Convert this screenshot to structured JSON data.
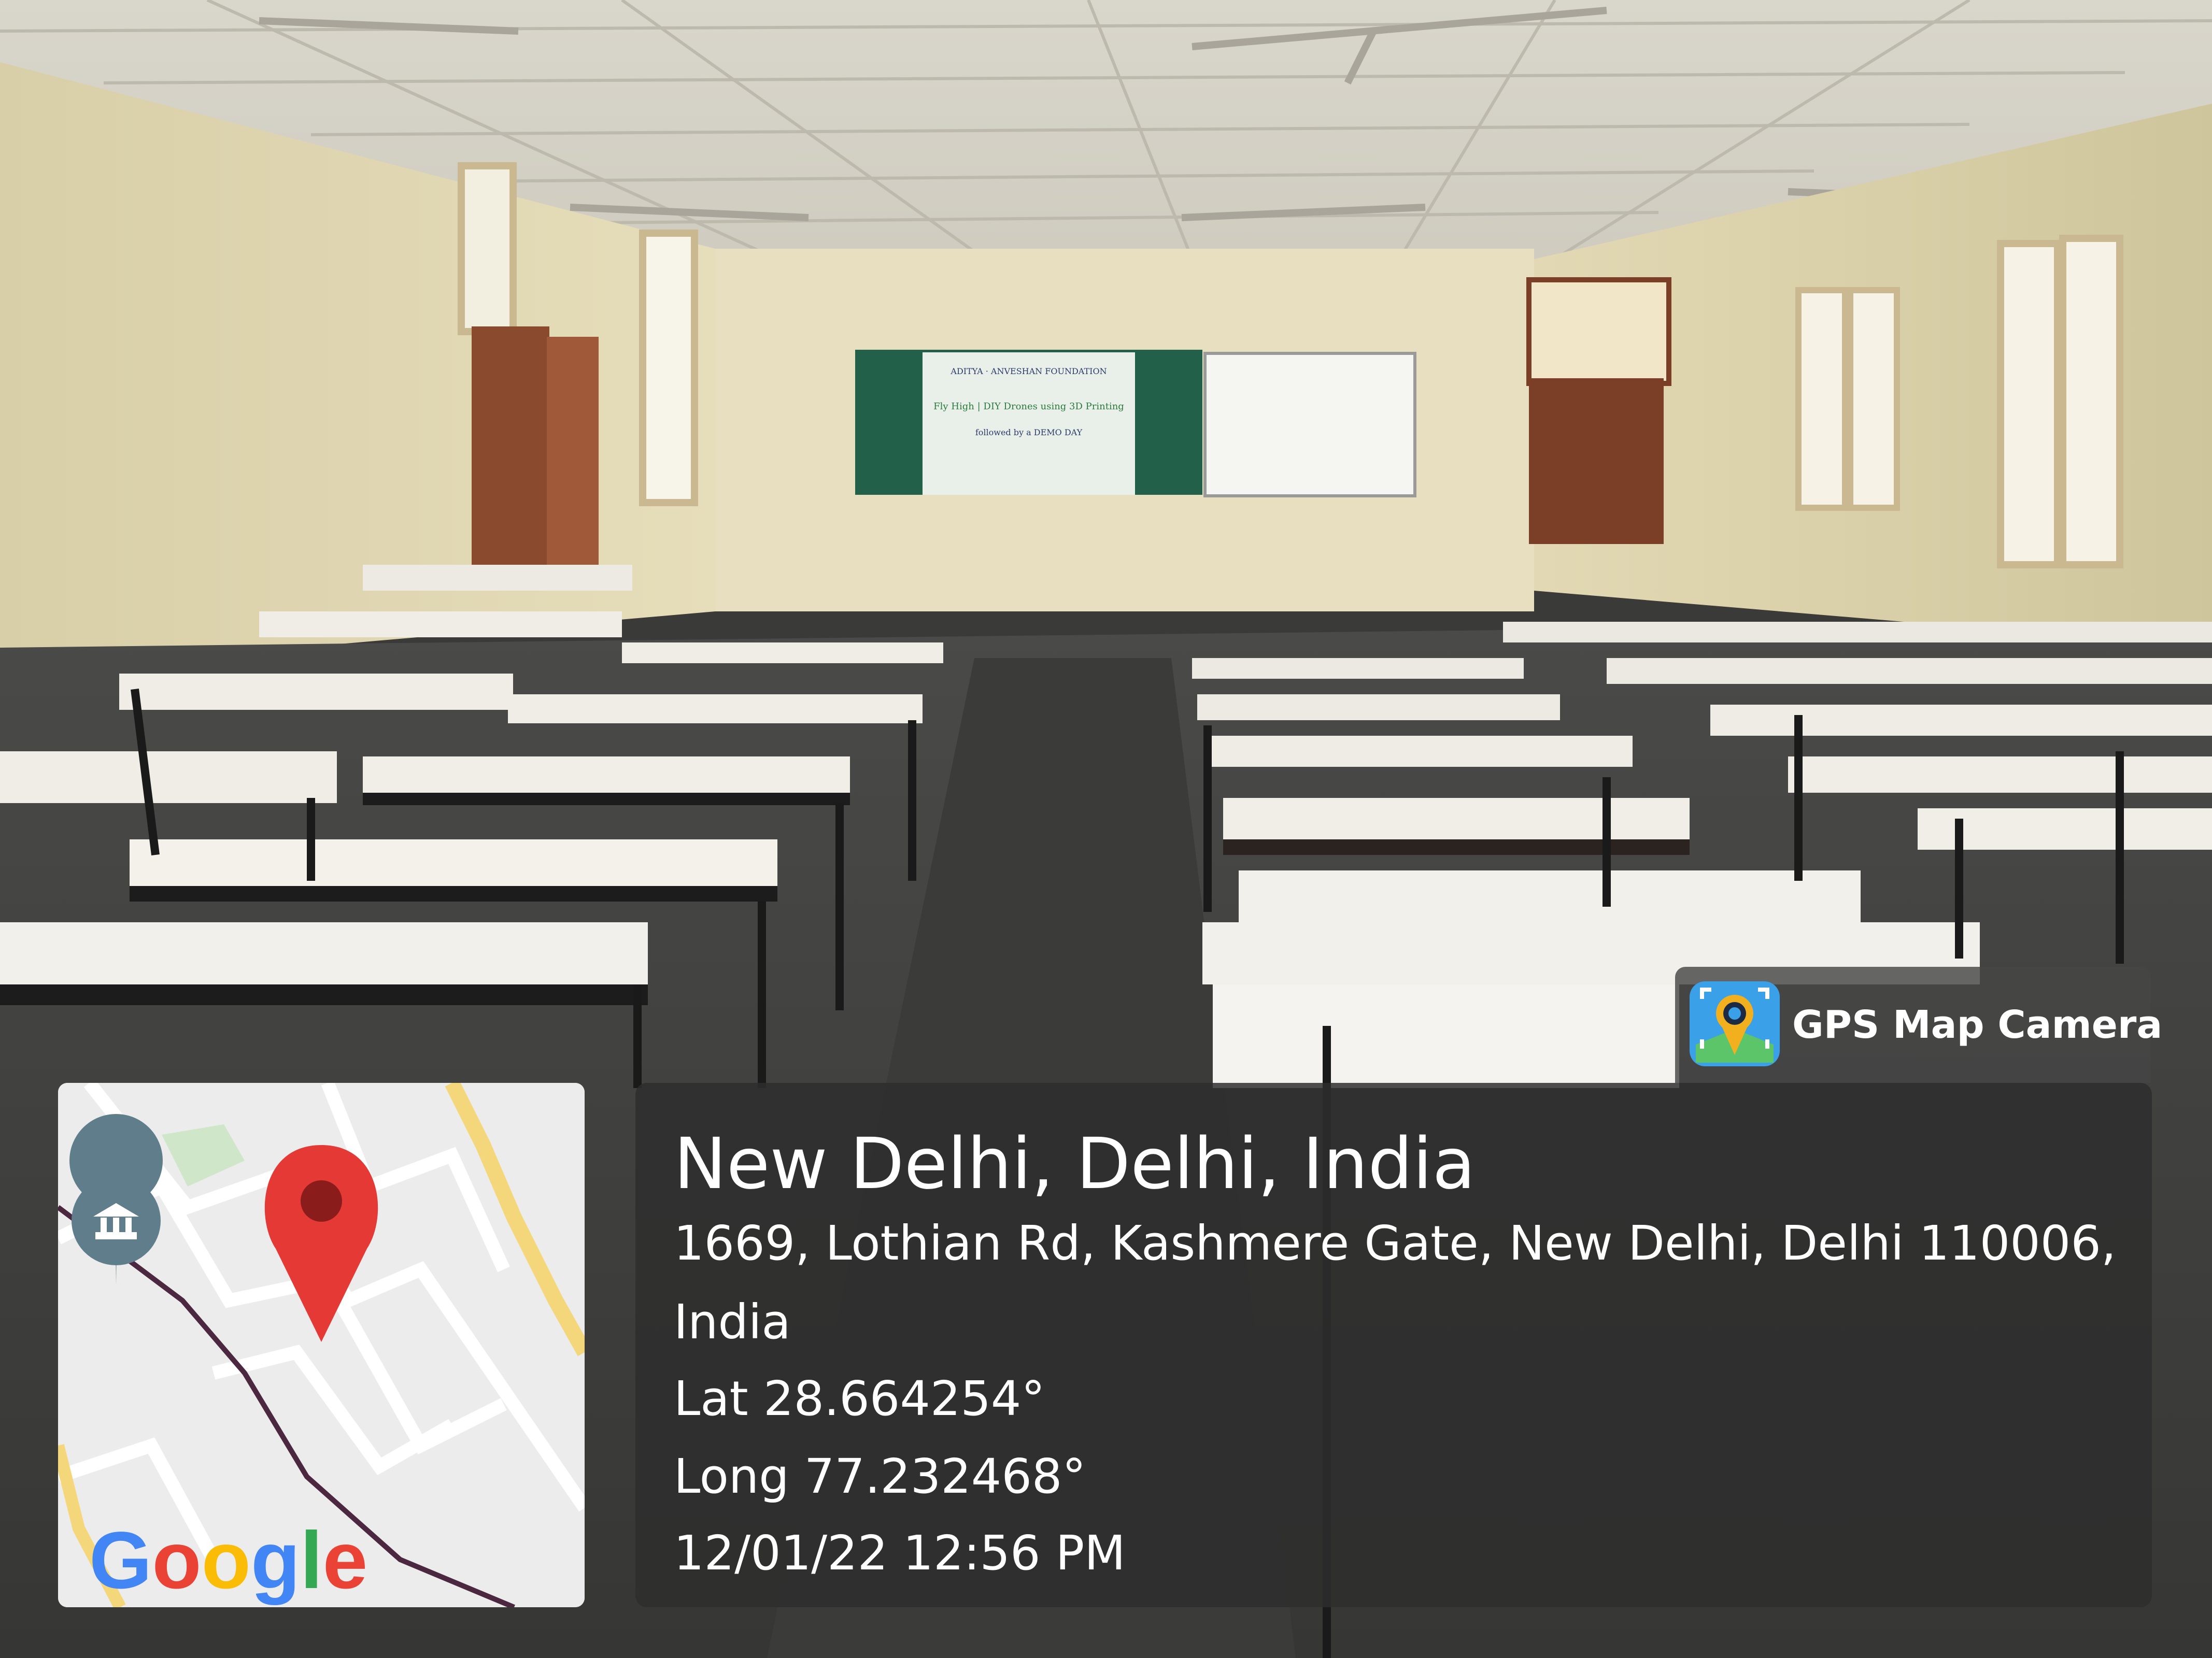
{
  "badge": {
    "label": "GPS Map Camera",
    "icon": "gps-map-camera-app-icon"
  },
  "map": {
    "brand": "Google",
    "pin_icon": "red-location-pin-icon",
    "poi_icon": "museum-poi-marker-icon"
  },
  "location": {
    "title": "New Delhi, Delhi, India",
    "address_line1": "1669, Lothian Rd, Kashmere Gate, New Delhi, Delhi 110006,",
    "address_line2": "India",
    "latitude": "Lat 28.664254°",
    "longitude": "Long 77.232468°",
    "datetime": "12/01/22 12:56 PM"
  },
  "scene": {
    "banner_lines": [
      "ADITYA · ANVESHAN FOUNDATION",
      "Fly High | DIY Drones using 3D Printing",
      "followed by a DEMO DAY"
    ]
  },
  "colors": {
    "panel": "#2d2d2d",
    "pin": "#e53935",
    "google_blue": "#4285F4",
    "google_red": "#EA4335",
    "google_yellow": "#FBBC05",
    "google_green": "#34A853"
  }
}
